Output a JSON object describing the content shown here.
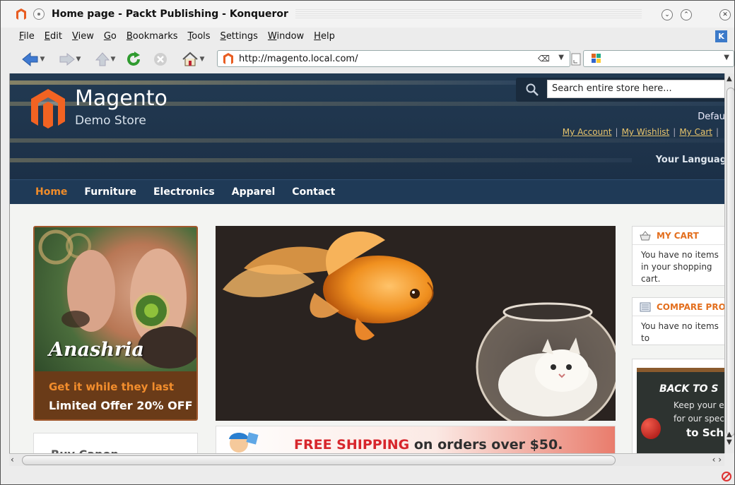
{
  "window": {
    "title": "Home page - Packt Publishing - Konqueror",
    "buttons": {
      "minimize": "⌄",
      "maximize": "⌃",
      "close": "✕"
    }
  },
  "menu": [
    "File",
    "Edit",
    "View",
    "Go",
    "Bookmarks",
    "Tools",
    "Settings",
    "Window",
    "Help"
  ],
  "toolbar": {
    "url": "http://magento.local.com/",
    "search_value": ""
  },
  "store": {
    "brand": "Magento",
    "brand_sub": "Demo Store",
    "search_placeholder": "Search entire store here...",
    "default_label": "Defau",
    "links": [
      "My Account",
      "My Wishlist",
      "My Cart"
    ],
    "language_label": "Your Languag",
    "nav": [
      "Home",
      "Furniture",
      "Electronics",
      "Apparel",
      "Contact"
    ],
    "banner_left": {
      "name": "Anashria",
      "tagline": "Get it while they last",
      "offer": "Limited Offer 20% OFF"
    },
    "banner_left2": "Buy Canon ",
    "shipping": {
      "highlight": "FREE SHIPPING",
      "rest": " on orders over $50."
    },
    "cart": {
      "title": "MY CART",
      "body": "You have no items in your shopping cart."
    },
    "compare": {
      "title": "COMPARE PRO",
      "body": "You have no items to"
    },
    "school": {
      "title": "BACK TO S",
      "line1": "Keep your e",
      "line2": "for our spec",
      "line3": "to Sch"
    }
  },
  "colors": {
    "header_bg": "#223a52",
    "nav_active": "#f08c2a",
    "link_gold": "#e9c56c",
    "accent_orange": "#e36f1e",
    "shipping_red": "#d7262c"
  }
}
